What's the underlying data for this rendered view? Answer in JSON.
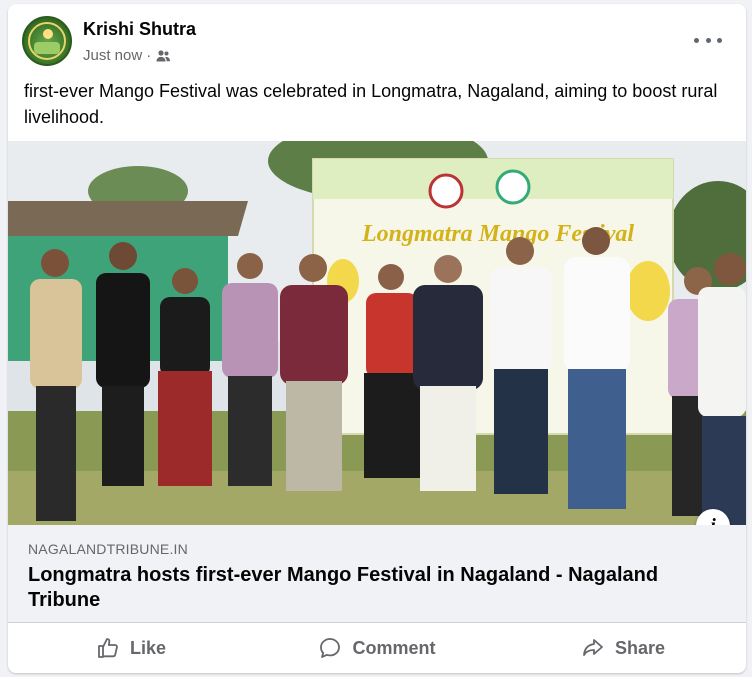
{
  "post": {
    "author": "Krishi Shutra",
    "timestamp": "Just now",
    "separator": "·",
    "audience_icon": "friends-icon",
    "caption": "first-ever Mango Festival was celebrated in Longmatra, Nagaland, aiming to boost rural livelihood.",
    "more_icon": "more-options-icon"
  },
  "photo": {
    "banner_text": "Longmatra Mango Festival",
    "info_icon": "info-icon",
    "info_glyph": "i"
  },
  "link": {
    "domain": "NAGALANDTRIBUNE.IN",
    "title": "Longmatra hosts first-ever Mango Festival in Nagaland - Nagaland Tribune"
  },
  "actions": {
    "like": "Like",
    "comment": "Comment",
    "share": "Share"
  },
  "colors": {
    "secondary_text": "#65676b",
    "primary_text": "#050505",
    "background": "#f0f2f5"
  }
}
